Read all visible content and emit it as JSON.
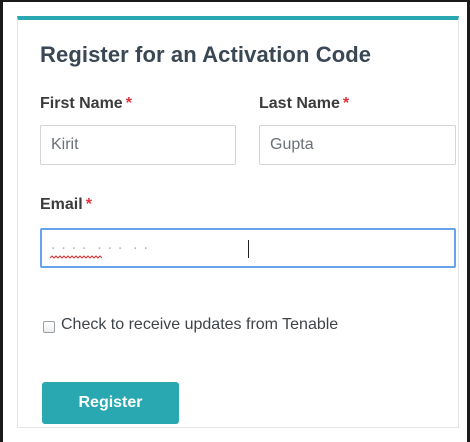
{
  "form": {
    "title": "Register for an Activation Code",
    "first_name": {
      "label": "First Name",
      "required_mark": "*",
      "value": "Kirit"
    },
    "last_name": {
      "label": "Last Name",
      "required_mark": "*",
      "value": "Gupta"
    },
    "email": {
      "label": "Email",
      "required_mark": "*",
      "value": ""
    },
    "updates_checkbox": {
      "label": "Check to receive updates from Tenable",
      "checked": false
    },
    "register_label": "Register"
  },
  "colors": {
    "accent": "#2aa8b1",
    "required": "#e0333a",
    "focus_border": "#66a3e8",
    "title": "#3a4754"
  }
}
